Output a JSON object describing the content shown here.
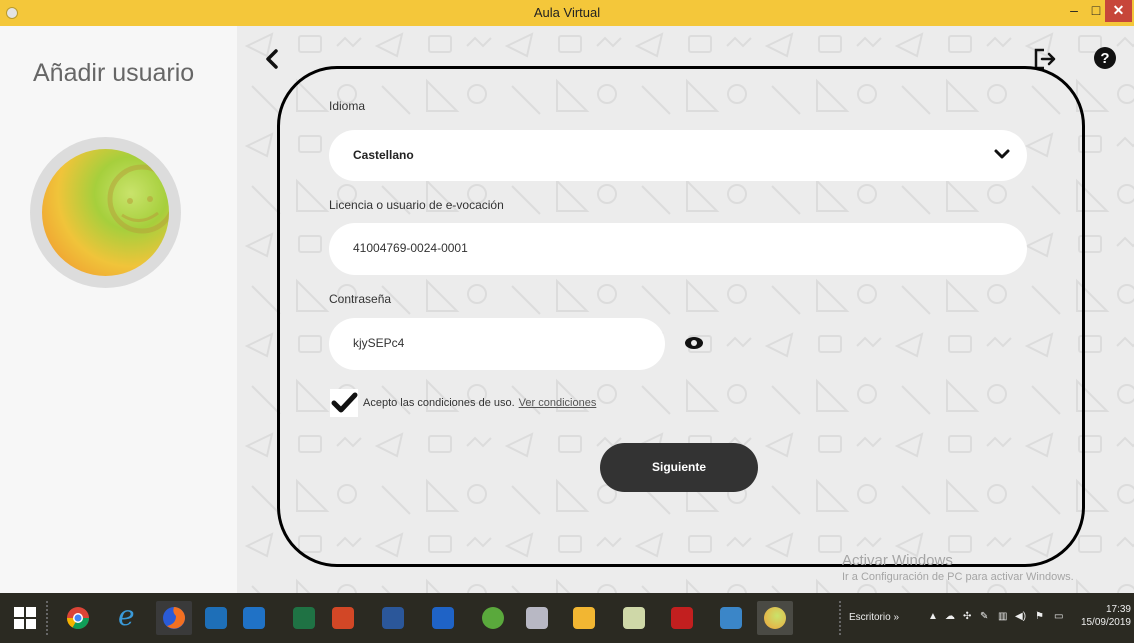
{
  "window": {
    "title": "Aula Virtual",
    "controls": {
      "minimize": "–",
      "maximize": "□",
      "close": "✕"
    }
  },
  "sidebar": {
    "heading": "Añadir usuario"
  },
  "form": {
    "language": {
      "label": "Idioma",
      "value": "Castellano"
    },
    "license": {
      "label": "Licencia o usuario de e-vocación",
      "value": "41004769-0024-0001"
    },
    "password": {
      "label": "Contraseña",
      "value": "kjySEPc4"
    },
    "terms": {
      "checked": true,
      "text": "Acepto las condiciones de uso.",
      "link": "Ver condiciones"
    },
    "submit_label": "Siguiente"
  },
  "watermark": {
    "line1": "Activar Windows",
    "line2": "Ir a Configuración de PC para activar Windows."
  },
  "taskbar": {
    "apps": [
      "windows-start",
      "chrome",
      "internet-explorer",
      "firefox",
      "terminal",
      "outlook",
      "excel",
      "powerpoint",
      "word",
      "onedrive",
      "utorrent",
      "paint",
      "drive",
      "notepad",
      "acrobat",
      "control-panel",
      "aula-virtual"
    ],
    "desktop_label": "Escritorio",
    "overflow": "»",
    "time": "17:39",
    "date": "15/09/2019"
  },
  "colors": {
    "titlebar": "#f4c73a",
    "button": "#333333",
    "close": "#c7463a",
    "taskbar": "#2b2a22"
  }
}
